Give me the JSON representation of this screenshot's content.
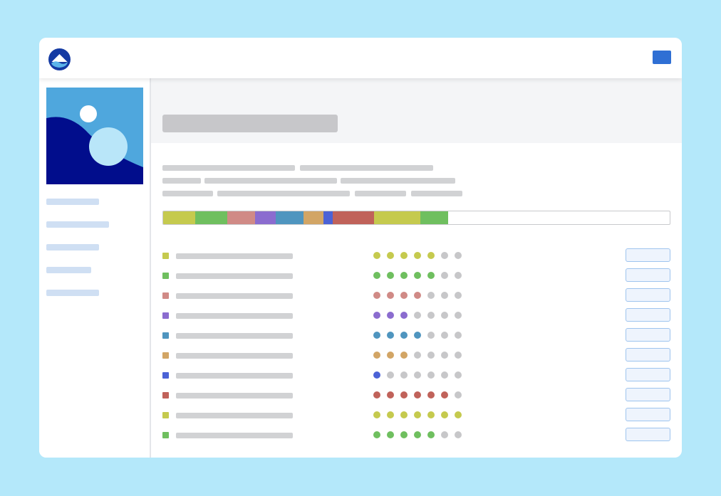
{
  "segments": [
    {
      "color": "#c5ca4e",
      "fraction": 0.063
    },
    {
      "color": "#6fbf5f",
      "fraction": 0.064
    },
    {
      "color": "#d08a86",
      "fraction": 0.055
    },
    {
      "color": "#8b6ccf",
      "fraction": 0.04
    },
    {
      "color": "#4f95bf",
      "fraction": 0.055
    },
    {
      "color": "#d2a565",
      "fraction": 0.04
    },
    {
      "color": "#4b62d6",
      "fraction": 0.018
    },
    {
      "color": "#c0625a",
      "fraction": 0.081
    },
    {
      "color": "#c5ca4e",
      "fraction": 0.092
    },
    {
      "color": "#6fbf5f",
      "fraction": 0.055
    }
  ],
  "rows": [
    {
      "color": "#c5ca4e",
      "rating": 5,
      "max": 7
    },
    {
      "color": "#6fbf5f",
      "rating": 5,
      "max": 7
    },
    {
      "color": "#d08a86",
      "rating": 4,
      "max": 7
    },
    {
      "color": "#8b6ccf",
      "rating": 3,
      "max": 7
    },
    {
      "color": "#4f95bf",
      "rating": 4,
      "max": 7
    },
    {
      "color": "#d2a565",
      "rating": 3,
      "max": 7
    },
    {
      "color": "#4b62d6",
      "rating": 1,
      "max": 7
    },
    {
      "color": "#c0625a",
      "rating": 6,
      "max": 7
    },
    {
      "color": "#c5ca4e",
      "rating": 7,
      "max": 7
    },
    {
      "color": "#6fbf5f",
      "rating": 5,
      "max": 7
    }
  ],
  "colors": {
    "accent": "#2f6fd4",
    "placeholder": "#d1d2d4",
    "nav_placeholder": "#cfdff3",
    "dot_empty": "#c7c7c9",
    "background": "#b4e8fa"
  },
  "icons": {
    "logo": "mountain-logo-icon",
    "hero": "landscape-image-icon"
  }
}
